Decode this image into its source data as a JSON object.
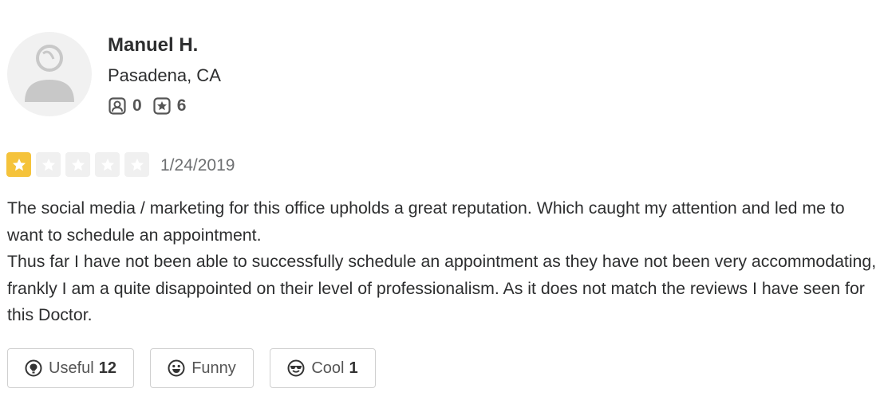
{
  "reviewer": {
    "name": "Manuel H.",
    "location": "Pasadena, CA",
    "avatar_icon": "default-user-icon",
    "friends_icon": "friends-icon",
    "friends_count": "0",
    "reviews_icon": "review-star-icon",
    "reviews_count": "6"
  },
  "review": {
    "rating": 1,
    "max_rating": 5,
    "star_color": "#f5c33b",
    "star_empty_color": "#f0f0f0",
    "date": "1/24/2019",
    "paragraphs": [
      "The social media / marketing for this office upholds a great reputation. Which caught my attention and led me to want to schedule an appointment.",
      "Thus far I have not been able to successfully schedule an appointment as they have not been very accommodating,  frankly I am a quite disappointed on their level of professionalism. As it does not match the reviews I have seen for this Doctor."
    ]
  },
  "votes": {
    "useful": {
      "label": "Useful",
      "count": "12",
      "icon": "lightbulb-icon"
    },
    "funny": {
      "label": "Funny",
      "count": "",
      "icon": "smiley-icon"
    },
    "cool": {
      "label": "Cool",
      "count": "1",
      "icon": "sunglasses-icon"
    }
  }
}
